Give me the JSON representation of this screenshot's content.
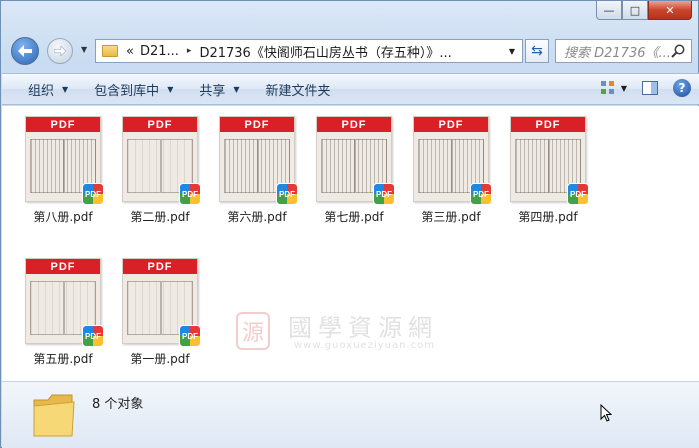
{
  "window": {
    "caption": {
      "minimize": "—",
      "maximize": "□",
      "close": "✕"
    }
  },
  "nav": {
    "back_icon": "back-arrow-icon",
    "forward_icon": "forward-arrow-icon",
    "address": {
      "prefix": "«",
      "crumb1": "D21...",
      "separator": "▸",
      "crumb2": "D21736《快阁师石山房丛书（存五种）》..."
    },
    "search_placeholder": "搜索 D21736《..."
  },
  "toolbar": {
    "organize": "组织",
    "include_in_library": "包含到库中",
    "share": "共享",
    "new_folder": "新建文件夹"
  },
  "files": [
    {
      "name": "第八册.pdf",
      "badge": "PDF"
    },
    {
      "name": "第二册.pdf",
      "badge": "PDF"
    },
    {
      "name": "第六册.pdf",
      "badge": "PDF"
    },
    {
      "name": "第七册.pdf",
      "badge": "PDF"
    },
    {
      "name": "第三册.pdf",
      "badge": "PDF"
    },
    {
      "name": "第四册.pdf",
      "badge": "PDF"
    },
    {
      "name": "第五册.pdf",
      "badge": "PDF"
    },
    {
      "name": "第一册.pdf",
      "badge": "PDF"
    }
  ],
  "thumb_label": "PDF",
  "watermark": {
    "seal": "源",
    "chinese": "國學資源網",
    "url": "www.guoxueziyuan.com"
  },
  "status": {
    "count_text": "8 个对象"
  }
}
